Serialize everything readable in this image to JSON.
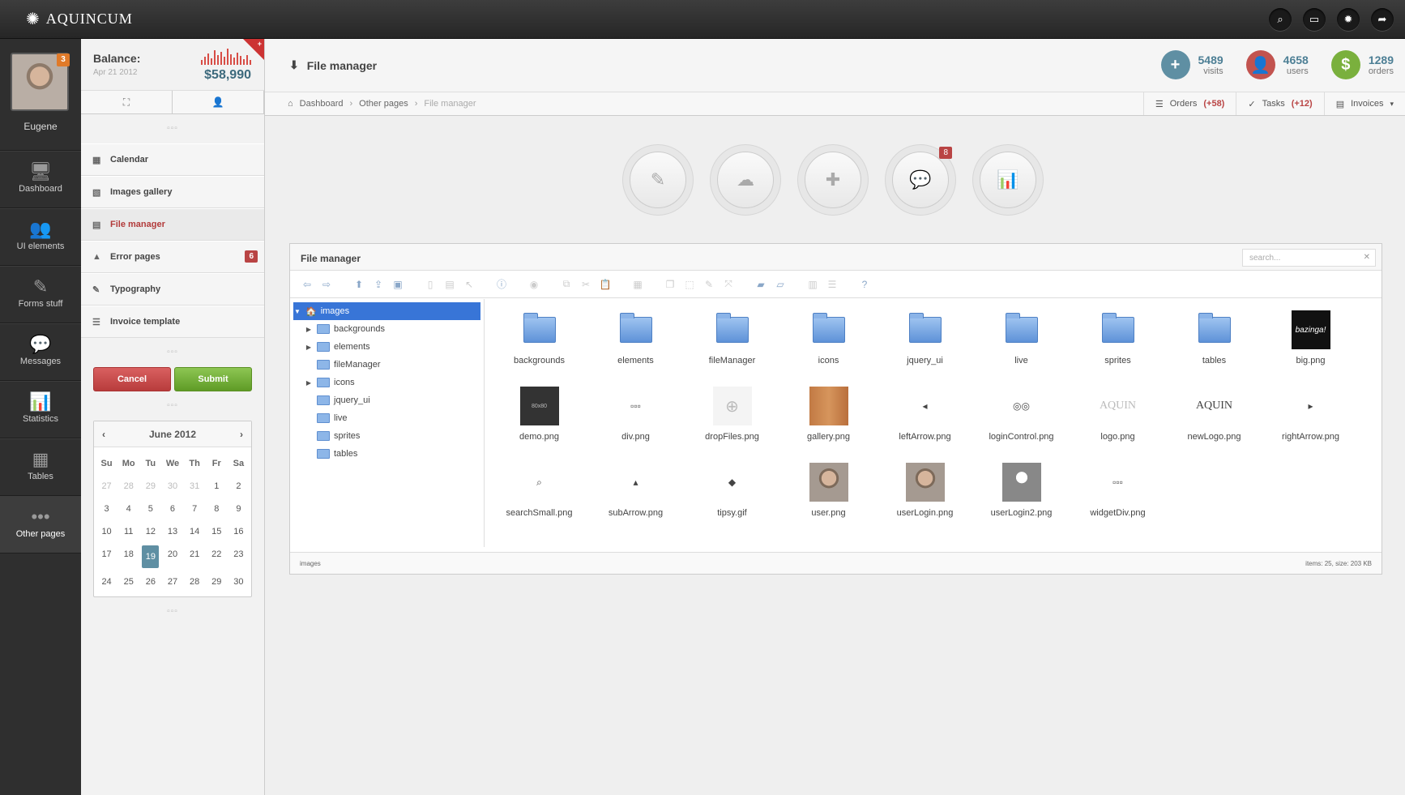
{
  "app": {
    "name": "AQUINCUM"
  },
  "topbar": {
    "icons": [
      "search-icon",
      "monitor-icon",
      "gear-icon",
      "share-icon"
    ]
  },
  "user": {
    "name": "Eugene",
    "badge": "3"
  },
  "leftnav": [
    {
      "label": "Dashboard",
      "icon": "monitor-icon"
    },
    {
      "label": "UI elements",
      "icon": "users-icon"
    },
    {
      "label": "Forms stuff",
      "icon": "edit-icon"
    },
    {
      "label": "Messages",
      "icon": "chat-icon"
    },
    {
      "label": "Statistics",
      "icon": "bar-chart-icon"
    },
    {
      "label": "Tables",
      "icon": "grid-icon"
    },
    {
      "label": "Other pages",
      "icon": "dots-icon",
      "active": true
    }
  ],
  "balance": {
    "title": "Balance:",
    "date": "Apr 21 2012",
    "amount": "$58,990",
    "plus": "+"
  },
  "sidebar": {
    "menu": [
      {
        "label": "Calendar",
        "icon": "calendar-icon"
      },
      {
        "label": "Images gallery",
        "icon": "image-icon"
      },
      {
        "label": "File manager",
        "icon": "file-manager-icon",
        "active": true
      },
      {
        "label": "Error pages",
        "icon": "warning-icon",
        "badge": "6"
      },
      {
        "label": "Typography",
        "icon": "edit-icon"
      },
      {
        "label": "Invoice template",
        "icon": "list-icon"
      }
    ],
    "cancel_label": "Cancel",
    "submit_label": "Submit"
  },
  "calendar": {
    "month": "June 2012",
    "prev": "‹",
    "next": "›",
    "dow": [
      "Su",
      "Mo",
      "Tu",
      "We",
      "Th",
      "Fr",
      "Sa"
    ],
    "weeks": [
      [
        "27",
        "28",
        "29",
        "30",
        "31",
        "1",
        "2"
      ],
      [
        "3",
        "4",
        "5",
        "6",
        "7",
        "8",
        "9"
      ],
      [
        "10",
        "11",
        "12",
        "13",
        "14",
        "15",
        "16"
      ],
      [
        "17",
        "18",
        "19",
        "20",
        "21",
        "22",
        "23"
      ],
      [
        "24",
        "25",
        "26",
        "27",
        "28",
        "29",
        "30"
      ]
    ],
    "today": "19"
  },
  "header": {
    "title": "File manager",
    "stats": [
      {
        "value": "5489",
        "label": "visits",
        "color": "#5f8fa3",
        "glyph": "+"
      },
      {
        "value": "4658",
        "label": "users",
        "color": "#c2534f",
        "glyph": "👤"
      },
      {
        "value": "1289",
        "label": "orders",
        "color": "#7ab03d",
        "glyph": "$"
      }
    ]
  },
  "breadcrumb": {
    "items": [
      "Dashboard",
      "Other pages",
      "File manager"
    ]
  },
  "crumbright": [
    {
      "label": "Orders",
      "count": "(+58)",
      "icon": "list-icon"
    },
    {
      "label": "Tasks",
      "count": "(+12)",
      "icon": "check-icon"
    },
    {
      "label": "Invoices",
      "count": "",
      "icon": "invoice-icon",
      "dropdown": true
    }
  ],
  "quick_circles": [
    {
      "icon": "edit-icon"
    },
    {
      "icon": "cloud-icon"
    },
    {
      "icon": "plus-icon"
    },
    {
      "icon": "chat-icon",
      "badge": "8"
    },
    {
      "icon": "bar-chart-icon"
    }
  ],
  "file_manager": {
    "title": "File manager",
    "search_placeholder": "search...",
    "tree": {
      "root": "images",
      "children": [
        {
          "name": "backgrounds",
          "expandable": true
        },
        {
          "name": "elements",
          "expandable": true
        },
        {
          "name": "fileManager",
          "expandable": false
        },
        {
          "name": "icons",
          "expandable": true
        },
        {
          "name": "jquery_ui",
          "expandable": false
        },
        {
          "name": "live",
          "expandable": false
        },
        {
          "name": "sprites",
          "expandable": false
        },
        {
          "name": "tables",
          "expandable": false
        }
      ]
    },
    "files": [
      {
        "name": "backgrounds",
        "type": "folder"
      },
      {
        "name": "elements",
        "type": "folder"
      },
      {
        "name": "fileManager",
        "type": "folder"
      },
      {
        "name": "icons",
        "type": "folder"
      },
      {
        "name": "jquery_ui",
        "type": "folder"
      },
      {
        "name": "live",
        "type": "folder"
      },
      {
        "name": "sprites",
        "type": "folder"
      },
      {
        "name": "tables",
        "type": "folder"
      },
      {
        "name": "big.png",
        "type": "image",
        "preview": "bazinga!"
      },
      {
        "name": "demo.png",
        "type": "image",
        "preview": "80x80"
      },
      {
        "name": "div.png",
        "type": "image",
        "preview": "▫▫▫"
      },
      {
        "name": "dropFiles.png",
        "type": "image",
        "preview": "⊕"
      },
      {
        "name": "gallery.png",
        "type": "image",
        "preview": ""
      },
      {
        "name": "leftArrow.png",
        "type": "image",
        "preview": "◂"
      },
      {
        "name": "loginControl.png",
        "type": "image",
        "preview": "◎◎"
      },
      {
        "name": "logo.png",
        "type": "image",
        "preview": "AQUIN"
      },
      {
        "name": "newLogo.png",
        "type": "image",
        "preview": "AQUIN"
      },
      {
        "name": "rightArrow.png",
        "type": "image",
        "preview": "▸"
      },
      {
        "name": "searchSmall.png",
        "type": "image",
        "preview": "⌕"
      },
      {
        "name": "subArrow.png",
        "type": "image",
        "preview": "▴"
      },
      {
        "name": "tipsy.gif",
        "type": "image",
        "preview": "◆"
      },
      {
        "name": "user.png",
        "type": "image",
        "preview": ""
      },
      {
        "name": "userLogin.png",
        "type": "image",
        "preview": ""
      },
      {
        "name": "userLogin2.png",
        "type": "image",
        "preview": ""
      },
      {
        "name": "widgetDiv.png",
        "type": "image",
        "preview": "▫▫▫"
      }
    ],
    "status_left": "images",
    "status_right": "items: 25, size: 203 KB"
  }
}
